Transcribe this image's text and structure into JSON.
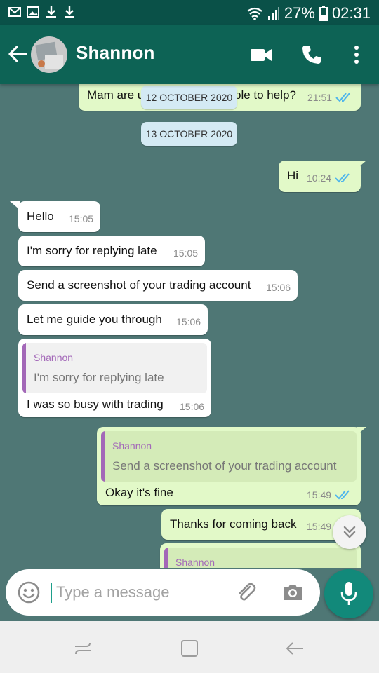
{
  "status_bar": {
    "battery_percent": "27%",
    "time": "02:31",
    "left_icons": [
      "gmail-icon",
      "gallery-icon",
      "download-icon",
      "download-icon"
    ]
  },
  "header": {
    "contact_name": "Shannon",
    "actions": [
      "video-call-icon",
      "voice-call-icon",
      "more-options-icon"
    ]
  },
  "messages": {
    "m0": {
      "text": "Mam are u",
      "text_after": "ble to help?",
      "time": "21:51",
      "read": true
    },
    "date1": "12 OCTOBER 2020",
    "date2": "13 OCTOBER 2020",
    "m1": {
      "text": "Hi",
      "time": "10:24",
      "read": true
    },
    "m2": {
      "text": "Hello",
      "time": "15:05"
    },
    "m3": {
      "text": "I'm sorry for replying late",
      "time": "15:05"
    },
    "m4": {
      "text": "Send a screenshot of your trading account",
      "time": "15:06"
    },
    "m5": {
      "text": "Let me guide you through",
      "time": "15:06"
    },
    "m6": {
      "quote_name": "Shannon",
      "quote_text": "I'm sorry for replying late",
      "text": "I was so busy with trading",
      "time": "15:06"
    },
    "m7": {
      "quote_name": "Shannon",
      "quote_text": "Send a screenshot of your trading account",
      "text": "Okay it's fine",
      "time": "15:49",
      "read": true
    },
    "m8": {
      "text": "Thanks for coming back",
      "time": "15:49"
    },
    "m9": {
      "quote_name": "Shannon"
    }
  },
  "input": {
    "placeholder": "Type a message"
  },
  "colors": {
    "header": "#0d6355",
    "status_bar": "#0a5148",
    "chat_background": "#4f7775",
    "incoming_bubble": "#ffffff",
    "outgoing_bubble": "#e2f9c8",
    "read_ticks": "#4fb6ec",
    "quote_name": "#a368b8",
    "mic_button": "#12897a"
  }
}
